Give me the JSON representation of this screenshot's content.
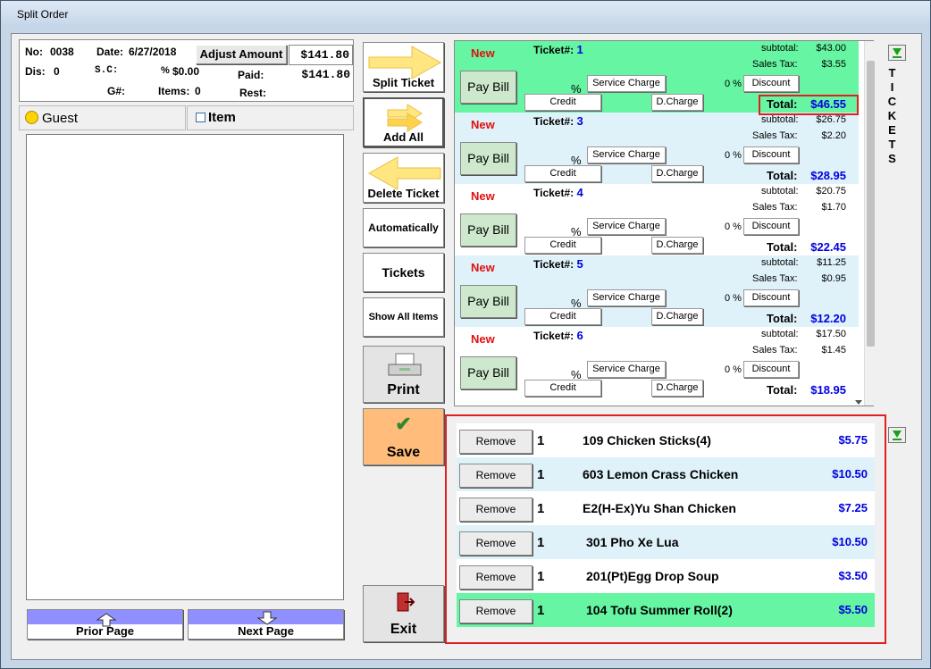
{
  "window": {
    "title": "Split Order"
  },
  "header": {
    "no_label": "No:",
    "no": "0038",
    "date_label": "Date:",
    "date": "6/27/2018",
    "adjust_label": "Adjust Amount",
    "amount": "$141.80",
    "dis_label": "Dis:",
    "dis": "0",
    "sc_label": "S.C:",
    "pct_label": "%",
    "sc_amount": "$0.00",
    "paid_label": "Paid:",
    "paid": "$141.80",
    "g_label": "G#:",
    "items_label": "Items:",
    "items": "0",
    "rest_label": "Rest:"
  },
  "left": {
    "guest_label": "Guest",
    "item_label": "Item",
    "prior_label": "Prior Page",
    "next_label": "Next Page"
  },
  "side": {
    "split": "Split Ticket",
    "addall": "Add All",
    "delete": "Delete Ticket",
    "auto": "Automatically",
    "tickets": "Tickets",
    "showall": "Show All Items",
    "print": "Print",
    "save": "Save",
    "exit": "Exit"
  },
  "tickets_label": "TICKETS",
  "labels": {
    "new": "New",
    "ticket": "Ticket#:",
    "paybill": "Pay Bill",
    "pct": "%",
    "service": "Service Charge",
    "zero": "0 %",
    "discount": "Discount",
    "credit": "Credit",
    "dcharge": "D.Charge",
    "subtotal": "subtotal:",
    "tax": "Sales Tax:",
    "total": "Total:"
  },
  "ticket_list": [
    {
      "num": "1",
      "subtotal": "$43.00",
      "tax": "$3.55",
      "total": "$46.55",
      "bg": "#66f5a2"
    },
    {
      "num": "3",
      "subtotal": "$26.75",
      "tax": "$2.20",
      "total": "$28.95",
      "bg": "#dff2fa"
    },
    {
      "num": "4",
      "subtotal": "$20.75",
      "tax": "$1.70",
      "total": "$22.45",
      "bg": "#ffffff"
    },
    {
      "num": "5",
      "subtotal": "$11.25",
      "tax": "$0.95",
      "total": "$12.20",
      "bg": "#dff2fa"
    },
    {
      "num": "6",
      "subtotal": "$17.50",
      "tax": "$1.45",
      "total": "$18.95",
      "bg": "#ffffff"
    }
  ],
  "item_list": [
    {
      "remove": "Remove",
      "qty": "1",
      "name": "109 Chicken Sticks(4)",
      "price": "$5.75",
      "bg": "#ffffff"
    },
    {
      "remove": "Remove",
      "qty": "1",
      "name": "603 Lemon Crass Chicken",
      "price": "$10.50",
      "bg": "#dff2fa"
    },
    {
      "remove": "Remove",
      "qty": "1",
      "name": "E2(H-Ex)Yu Shan Chicken",
      "price": "$7.25",
      "bg": "#ffffff"
    },
    {
      "remove": "Remove",
      "qty": "1",
      "name": "301 Pho Xe Lua",
      "price": "$10.50",
      "bg": "#dff2fa"
    },
    {
      "remove": "Remove",
      "qty": "1",
      "name": "201(Pt)Egg Drop Soup",
      "price": "$3.50",
      "bg": "#ffffff"
    },
    {
      "remove": "Remove",
      "qty": "1",
      "name": "104 Tofu Summer Roll(2)",
      "price": "$5.50",
      "bg": "#66f5a2"
    }
  ]
}
